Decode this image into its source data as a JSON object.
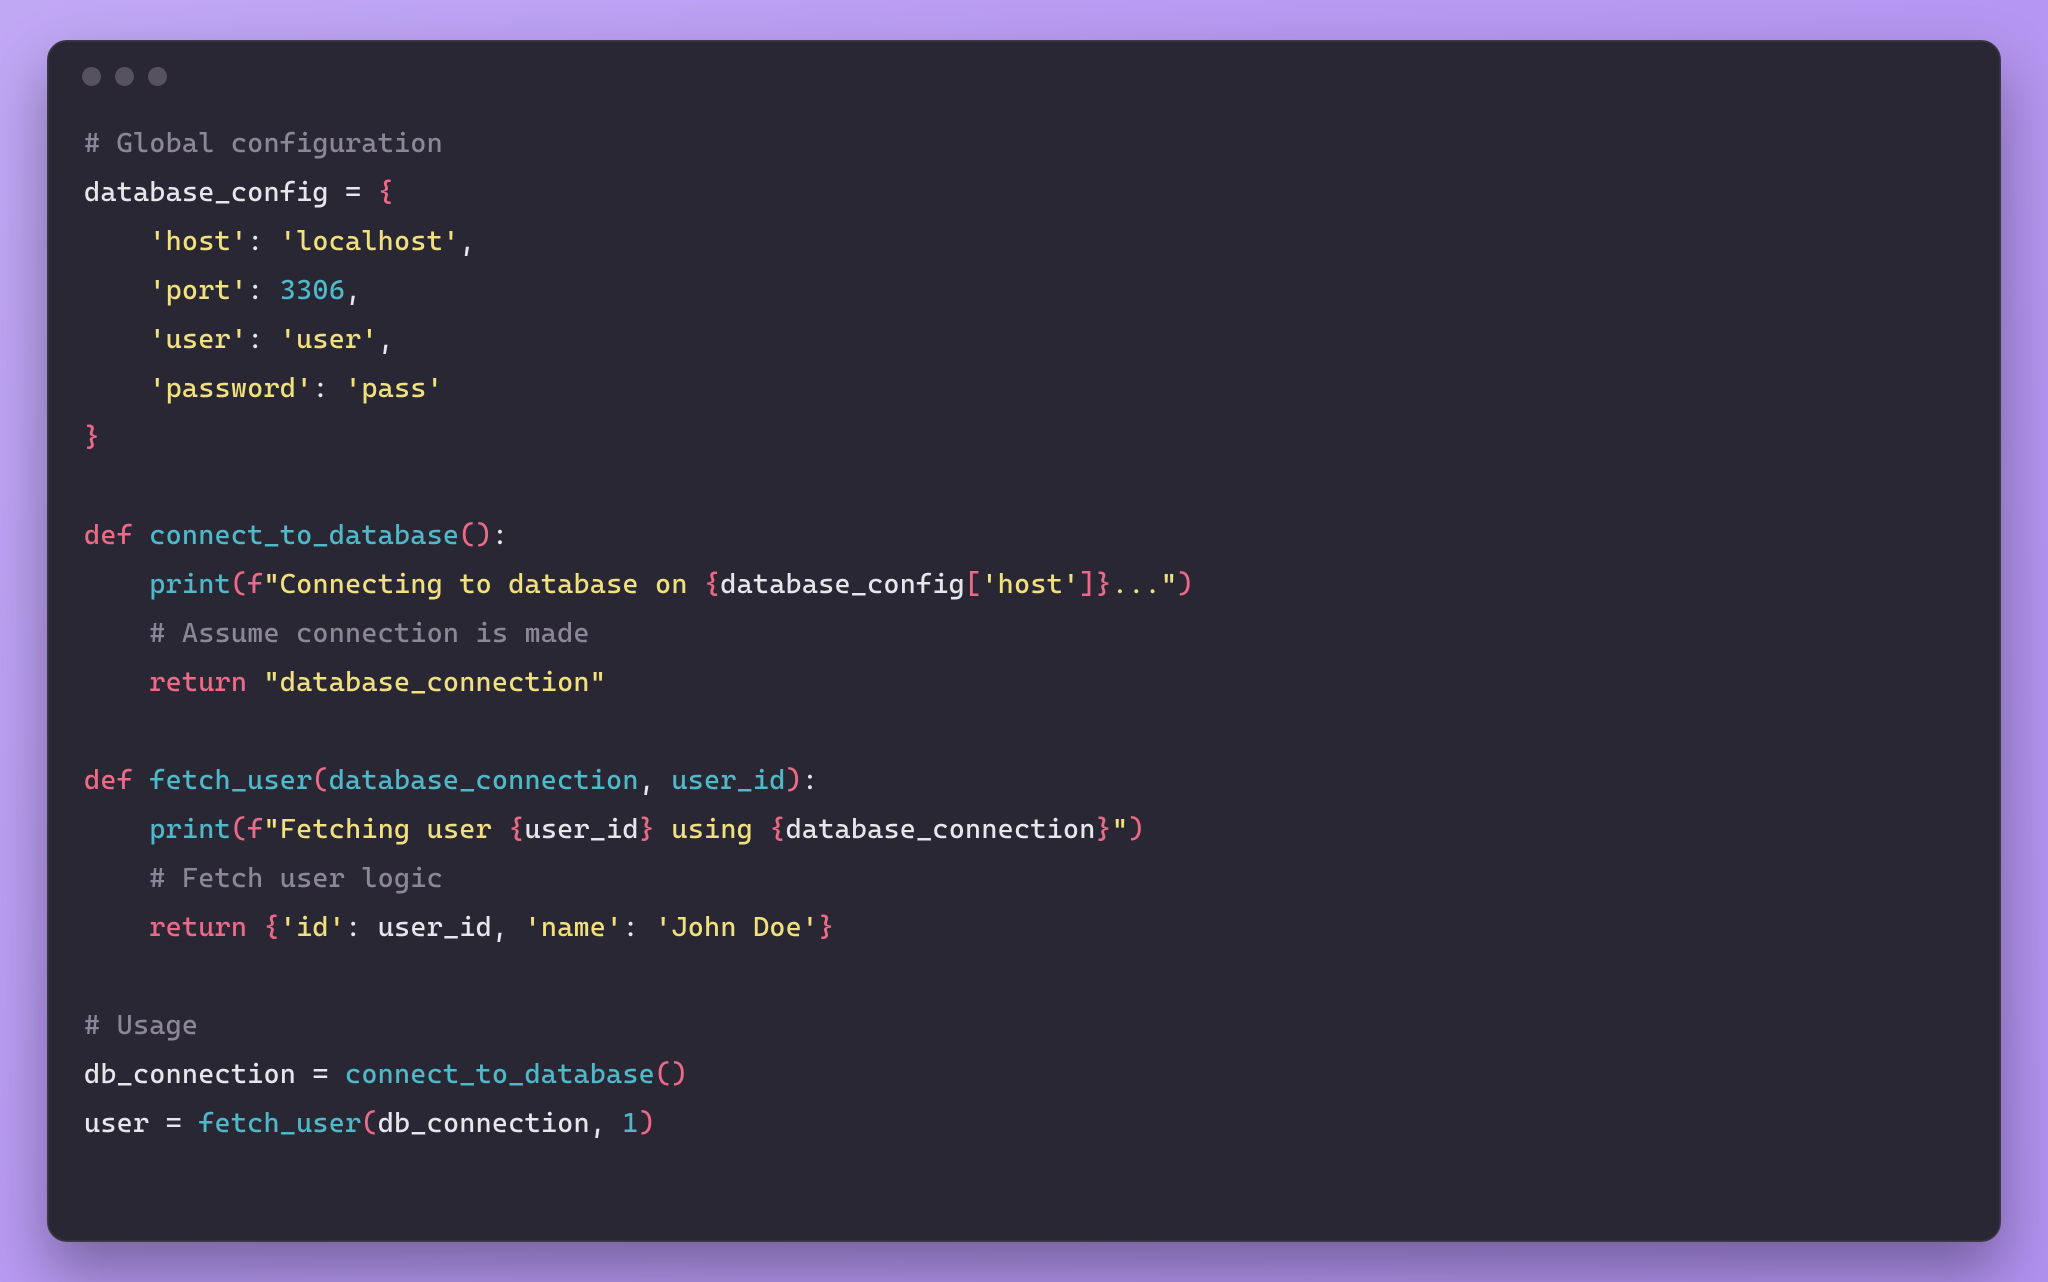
{
  "window": {
    "traffic_light_count": 3
  },
  "code": {
    "lines": [
      [
        {
          "cls": "tok-comment",
          "t": "# Global configuration"
        }
      ],
      [
        {
          "cls": "tok-name",
          "t": "database_config "
        },
        {
          "cls": "tok-punct",
          "t": "= "
        },
        {
          "cls": "tok-puncth",
          "t": "{"
        }
      ],
      [
        {
          "cls": "tok-name",
          "t": "    "
        },
        {
          "cls": "tok-string",
          "t": "'host'"
        },
        {
          "cls": "tok-punct",
          "t": ": "
        },
        {
          "cls": "tok-string",
          "t": "'localhost'"
        },
        {
          "cls": "tok-punct",
          "t": ","
        }
      ],
      [
        {
          "cls": "tok-name",
          "t": "    "
        },
        {
          "cls": "tok-string",
          "t": "'port'"
        },
        {
          "cls": "tok-punct",
          "t": ": "
        },
        {
          "cls": "tok-number",
          "t": "3306"
        },
        {
          "cls": "tok-punct",
          "t": ","
        }
      ],
      [
        {
          "cls": "tok-name",
          "t": "    "
        },
        {
          "cls": "tok-string",
          "t": "'user'"
        },
        {
          "cls": "tok-punct",
          "t": ": "
        },
        {
          "cls": "tok-string",
          "t": "'user'"
        },
        {
          "cls": "tok-punct",
          "t": ","
        }
      ],
      [
        {
          "cls": "tok-name",
          "t": "    "
        },
        {
          "cls": "tok-string",
          "t": "'password'"
        },
        {
          "cls": "tok-punct",
          "t": ": "
        },
        {
          "cls": "tok-string",
          "t": "'pass'"
        }
      ],
      [
        {
          "cls": "tok-puncth",
          "t": "}"
        }
      ],
      [
        {
          "cls": "tok-name",
          "t": ""
        }
      ],
      [
        {
          "cls": "tok-keyword",
          "t": "def "
        },
        {
          "cls": "tok-funcname",
          "t": "connect_to_database"
        },
        {
          "cls": "tok-puncth",
          "t": "()"
        },
        {
          "cls": "tok-punct",
          "t": ":"
        }
      ],
      [
        {
          "cls": "tok-name",
          "t": "    "
        },
        {
          "cls": "tok-builtin",
          "t": "print"
        },
        {
          "cls": "tok-puncth",
          "t": "("
        },
        {
          "cls": "tok-fprefix",
          "t": "f"
        },
        {
          "cls": "tok-string",
          "t": "\"Connecting to database on "
        },
        {
          "cls": "tok-interp",
          "t": "{"
        },
        {
          "cls": "tok-name",
          "t": "database_config"
        },
        {
          "cls": "tok-puncth",
          "t": "["
        },
        {
          "cls": "tok-string",
          "t": "'host'"
        },
        {
          "cls": "tok-puncth",
          "t": "]"
        },
        {
          "cls": "tok-interp",
          "t": "}"
        },
        {
          "cls": "tok-string",
          "t": "...\""
        },
        {
          "cls": "tok-puncth",
          "t": ")"
        }
      ],
      [
        {
          "cls": "tok-name",
          "t": "    "
        },
        {
          "cls": "tok-comment",
          "t": "# Assume connection is made"
        }
      ],
      [
        {
          "cls": "tok-name",
          "t": "    "
        },
        {
          "cls": "tok-keyword",
          "t": "return "
        },
        {
          "cls": "tok-string",
          "t": "\"database_connection\""
        }
      ],
      [
        {
          "cls": "tok-name",
          "t": ""
        }
      ],
      [
        {
          "cls": "tok-keyword",
          "t": "def "
        },
        {
          "cls": "tok-funcname",
          "t": "fetch_user"
        },
        {
          "cls": "tok-puncth",
          "t": "("
        },
        {
          "cls": "tok-param",
          "t": "database_connection"
        },
        {
          "cls": "tok-punct",
          "t": ", "
        },
        {
          "cls": "tok-param",
          "t": "user_id"
        },
        {
          "cls": "tok-puncth",
          "t": ")"
        },
        {
          "cls": "tok-punct",
          "t": ":"
        }
      ],
      [
        {
          "cls": "tok-name",
          "t": "    "
        },
        {
          "cls": "tok-builtin",
          "t": "print"
        },
        {
          "cls": "tok-puncth",
          "t": "("
        },
        {
          "cls": "tok-fprefix",
          "t": "f"
        },
        {
          "cls": "tok-string",
          "t": "\"Fetching user "
        },
        {
          "cls": "tok-interp",
          "t": "{"
        },
        {
          "cls": "tok-name",
          "t": "user_id"
        },
        {
          "cls": "tok-interp",
          "t": "}"
        },
        {
          "cls": "tok-string",
          "t": " using "
        },
        {
          "cls": "tok-interp",
          "t": "{"
        },
        {
          "cls": "tok-name",
          "t": "database_connection"
        },
        {
          "cls": "tok-interp",
          "t": "}"
        },
        {
          "cls": "tok-string",
          "t": "\""
        },
        {
          "cls": "tok-puncth",
          "t": ")"
        }
      ],
      [
        {
          "cls": "tok-name",
          "t": "    "
        },
        {
          "cls": "tok-comment",
          "t": "# Fetch user logic"
        }
      ],
      [
        {
          "cls": "tok-name",
          "t": "    "
        },
        {
          "cls": "tok-keyword",
          "t": "return "
        },
        {
          "cls": "tok-puncth",
          "t": "{"
        },
        {
          "cls": "tok-string",
          "t": "'id'"
        },
        {
          "cls": "tok-punct",
          "t": ": "
        },
        {
          "cls": "tok-name",
          "t": "user_id"
        },
        {
          "cls": "tok-punct",
          "t": ", "
        },
        {
          "cls": "tok-string",
          "t": "'name'"
        },
        {
          "cls": "tok-punct",
          "t": ": "
        },
        {
          "cls": "tok-string",
          "t": "'John Doe'"
        },
        {
          "cls": "tok-puncth",
          "t": "}"
        }
      ],
      [
        {
          "cls": "tok-name",
          "t": ""
        }
      ],
      [
        {
          "cls": "tok-comment",
          "t": "# Usage"
        }
      ],
      [
        {
          "cls": "tok-name",
          "t": "db_connection "
        },
        {
          "cls": "tok-punct",
          "t": "= "
        },
        {
          "cls": "tok-funcname",
          "t": "connect_to_database"
        },
        {
          "cls": "tok-puncth",
          "t": "()"
        }
      ],
      [
        {
          "cls": "tok-name",
          "t": "user "
        },
        {
          "cls": "tok-punct",
          "t": "= "
        },
        {
          "cls": "tok-funcname",
          "t": "fetch_user"
        },
        {
          "cls": "tok-puncth",
          "t": "("
        },
        {
          "cls": "tok-name",
          "t": "db_connection"
        },
        {
          "cls": "tok-punct",
          "t": ", "
        },
        {
          "cls": "tok-number",
          "t": "1"
        },
        {
          "cls": "tok-puncth",
          "t": ")"
        }
      ]
    ]
  }
}
